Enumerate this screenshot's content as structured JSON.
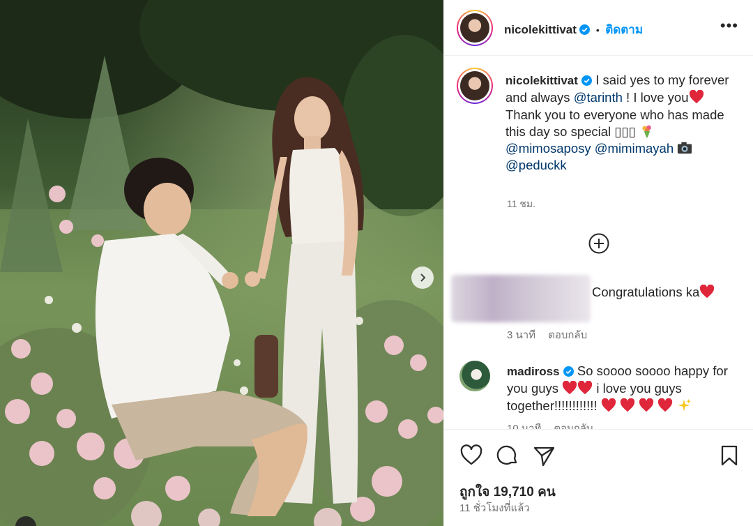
{
  "post": {
    "username": "nicolekittivat",
    "follow_label": "ติดตาม",
    "dot": "•",
    "more_label": "•••"
  },
  "caption": {
    "username": "nicolekittivat",
    "part1": " I said yes to my forever and always ",
    "mention1": "@tarinth",
    "part2": " ! I love you",
    "part3": " Thank you to everyone who has made this day so special ",
    "boxes": "▯▯▯",
    "mention2": "@mimosaposy",
    "mention3": "@mimimayah",
    "mention4": "@peduckk",
    "time": "11 ชม."
  },
  "comments": [
    {
      "text": "Congratulations ka",
      "time": "3 นาที",
      "reply_label": "ตอบกลับ"
    },
    {
      "username": "madiross",
      "part1": " So soooo soooo happy for you guys ",
      "part2": " i love you guys together!!!!!!!!!!!! ",
      "time": "10 นาที",
      "reply_label": "ตอบกลับ"
    }
  ],
  "footer": {
    "likes": "ถูกใจ 19,710 คน",
    "posted_ago": "11 ชั่วโมงที่แล้ว"
  },
  "icons": {
    "verified": "verified-badge-icon",
    "load_more": "plus-circle-icon",
    "like": "heart-outline-icon",
    "comment": "comment-bubble-icon",
    "share": "paper-plane-icon",
    "save": "bookmark-icon",
    "next": "chevron-right-icon"
  },
  "colors": {
    "link": "#0095f6",
    "mention": "#00376b",
    "muted": "#737373",
    "heart": "#ed4956"
  }
}
